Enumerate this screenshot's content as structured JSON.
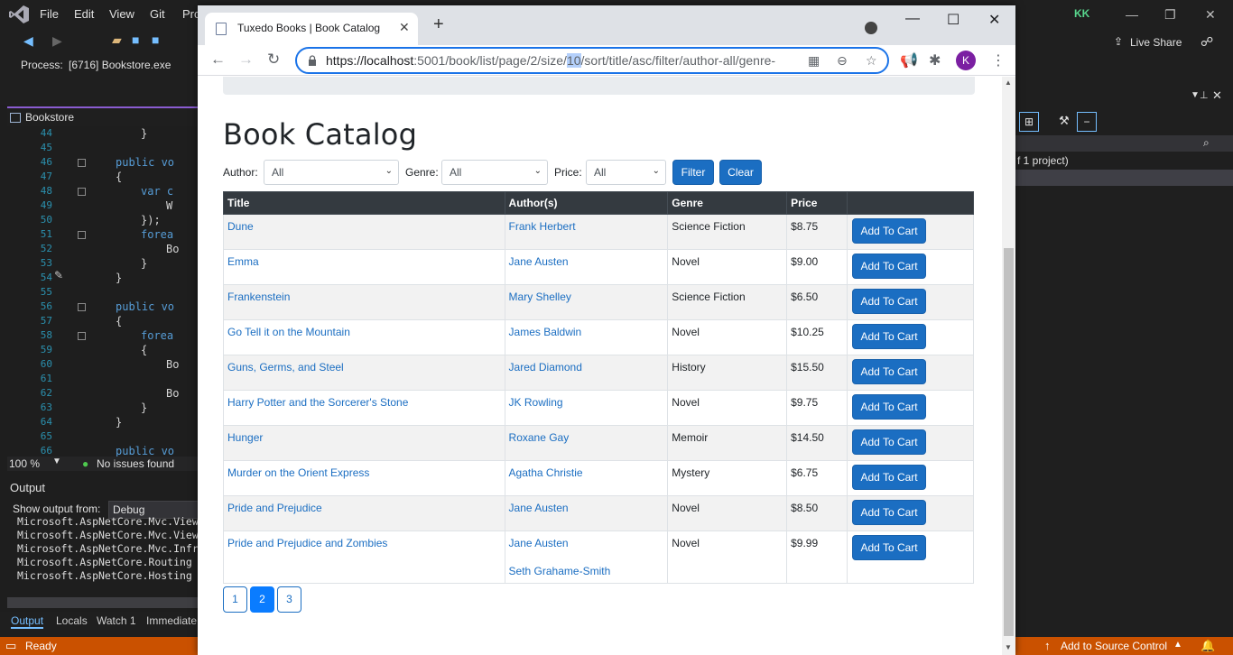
{
  "vs": {
    "menu": [
      "File",
      "Edit",
      "View",
      "Git",
      "Pro"
    ],
    "process_label": "Process:",
    "process_value": "[6716] Bookstore.exe",
    "doc_tab": "Bookstore",
    "account_initials": "KK",
    "live_share": "Live Share",
    "code_lines": [
      {
        "n": "44",
        "t": "}"
      },
      {
        "n": "45",
        "t": ""
      },
      {
        "n": "46",
        "t": "public vo"
      },
      {
        "n": "47",
        "t": "{"
      },
      {
        "n": "48",
        "t": "var c"
      },
      {
        "n": "49",
        "t": "W"
      },
      {
        "n": "50",
        "t": "});"
      },
      {
        "n": "51",
        "t": "forea"
      },
      {
        "n": "52",
        "t": "Bo"
      },
      {
        "n": "53",
        "t": "}"
      },
      {
        "n": "54",
        "t": "}"
      },
      {
        "n": "55",
        "t": ""
      },
      {
        "n": "56",
        "t": "public vo"
      },
      {
        "n": "57",
        "t": "{"
      },
      {
        "n": "58",
        "t": "forea"
      },
      {
        "n": "59",
        "t": "{"
      },
      {
        "n": "60",
        "t": "Bo"
      },
      {
        "n": "61",
        "t": ""
      },
      {
        "n": "62",
        "t": "Bo"
      },
      {
        "n": "63",
        "t": "}"
      },
      {
        "n": "64",
        "t": "}"
      },
      {
        "n": "65",
        "t": ""
      },
      {
        "n": "66",
        "t": "public vo"
      }
    ],
    "zoom": "100 %",
    "issues": "No issues found",
    "output_title": "Output",
    "output_from_label": "Show output from:",
    "output_from_value": "Debug",
    "output_lines": [
      "Microsoft.AspNetCore.Mvc.View",
      "Microsoft.AspNetCore.Mvc.View",
      "Microsoft.AspNetCore.Mvc.Infr",
      "Microsoft.AspNetCore.Routing",
      "Microsoft.AspNetCore.Hosting"
    ],
    "bottom_tabs": [
      "Output",
      "Locals",
      "Watch 1",
      "Immediate"
    ],
    "status_ready": "Ready",
    "status_source": "Add to Source Control",
    "solution_line": "f 1 project)"
  },
  "chrome": {
    "tab_title": "Tuxedo Books | Book Catalog",
    "url_host": "https://localhost",
    "url_port_path_a": ":5001/book/list/page/2/size/",
    "url_highlight": "10",
    "url_rest": "/sort/title/asc/filter/author-all/genre-",
    "profile_initial": "K"
  },
  "page": {
    "title": "Book Catalog",
    "filters": {
      "author_label": "Author:",
      "author_value": "All",
      "genre_label": "Genre:",
      "genre_value": "All",
      "price_label": "Price:",
      "price_value": "All",
      "filter_btn": "Filter",
      "clear_btn": "Clear"
    },
    "table": {
      "headers": [
        "Title",
        "Author(s)",
        "Genre",
        "Price",
        ""
      ],
      "add_label": "Add To Cart",
      "rows": [
        {
          "title": "Dune",
          "authors": [
            "Frank Herbert"
          ],
          "genre": "Science Fiction",
          "price": "$8.75"
        },
        {
          "title": "Emma",
          "authors": [
            "Jane Austen"
          ],
          "genre": "Novel",
          "price": "$9.00"
        },
        {
          "title": "Frankenstein",
          "authors": [
            "Mary Shelley"
          ],
          "genre": "Science Fiction",
          "price": "$6.50"
        },
        {
          "title": "Go Tell it on the Mountain",
          "authors": [
            "James Baldwin"
          ],
          "genre": "Novel",
          "price": "$10.25"
        },
        {
          "title": "Guns, Germs, and Steel",
          "authors": [
            "Jared Diamond"
          ],
          "genre": "History",
          "price": "$15.50"
        },
        {
          "title": "Harry Potter and the Sorcerer's Stone",
          "authors": [
            "JK Rowling"
          ],
          "genre": "Novel",
          "price": "$9.75"
        },
        {
          "title": "Hunger",
          "authors": [
            "Roxane Gay"
          ],
          "genre": "Memoir",
          "price": "$14.50"
        },
        {
          "title": "Murder on the Orient Express",
          "authors": [
            "Agatha Christie"
          ],
          "genre": "Mystery",
          "price": "$6.75"
        },
        {
          "title": "Pride and Prejudice",
          "authors": [
            "Jane Austen"
          ],
          "genre": "Novel",
          "price": "$8.50"
        },
        {
          "title": "Pride and Prejudice and Zombies",
          "authors": [
            "Jane Austen",
            "Seth Grahame-Smith"
          ],
          "genre": "Novel",
          "price": "$9.99"
        }
      ]
    },
    "pager": {
      "pages": [
        "1",
        "2",
        "3"
      ],
      "current": "2"
    }
  },
  "colors": {
    "link": "#1b6ec2",
    "primary": "#1b6ec2",
    "vs_status": "#ca5100",
    "header_dark": "#343a40"
  }
}
